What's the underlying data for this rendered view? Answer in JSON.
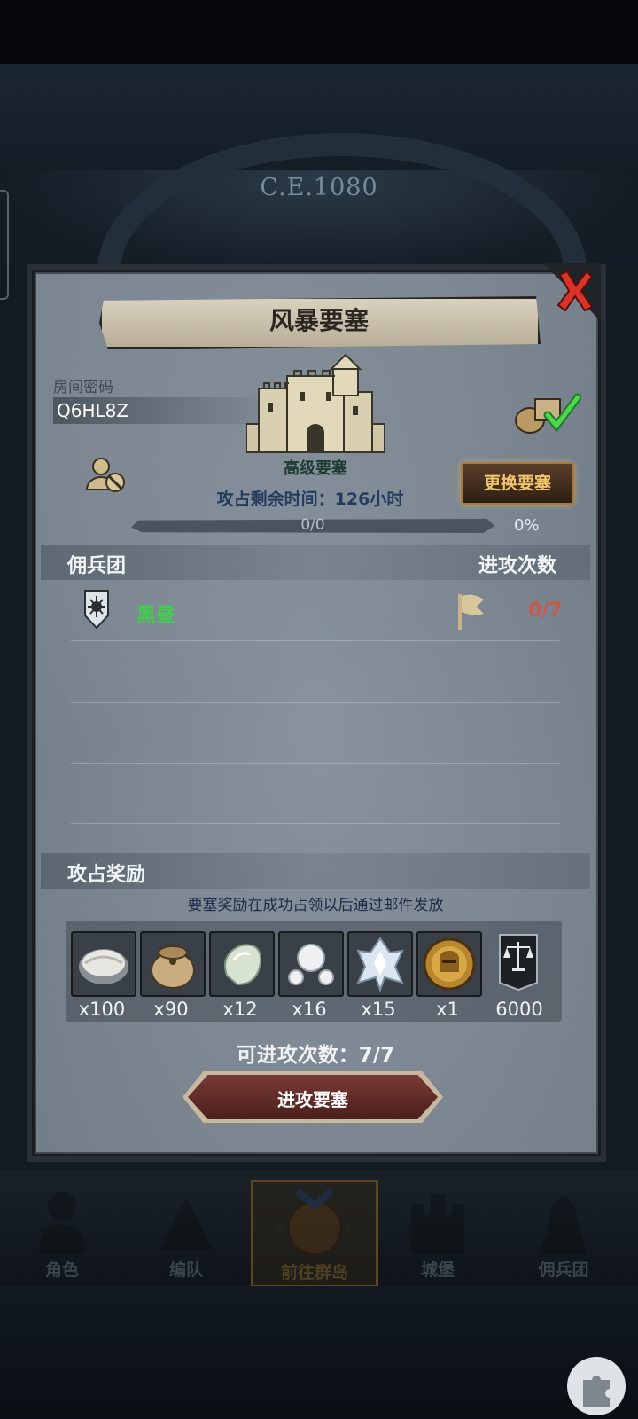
{
  "background": {
    "era_label": "C.E.1080"
  },
  "dialog": {
    "title": "风暴要塞",
    "room_code_label": "房间密码",
    "room_code": "Q6HL8Z",
    "fortress_level": "高级要塞",
    "change_button": "更换要塞",
    "time_remaining_label": "攻占剩余时间：",
    "time_remaining_value": "126小时",
    "progress_text": "0/0",
    "progress_percent": "0%",
    "progress_fraction": 0,
    "columns": {
      "mercenary": "佣兵团",
      "attacks": "进攻次数"
    },
    "rows": [
      {
        "guild": "黑昼",
        "attacks": "0/7"
      }
    ],
    "rewards_title": "攻占奖励",
    "rewards_note": "要塞奖励在成功占领以后通过邮件发放",
    "rewards": [
      {
        "icon": "oyster-icon",
        "qty": "x100"
      },
      {
        "icon": "sack-icon",
        "qty": "x90"
      },
      {
        "icon": "jade-stone-icon",
        "qty": "x12"
      },
      {
        "icon": "pearls-icon",
        "qty": "x16"
      },
      {
        "icon": "crystal-icon",
        "qty": "x15"
      },
      {
        "icon": "knight-medal-icon",
        "qty": "x1"
      },
      {
        "icon": "scales-banner-icon",
        "qty": "6000"
      }
    ],
    "available_attacks_label": "可进攻次数：",
    "available_attacks_value": "7/7",
    "attack_button": "进攻要塞"
  },
  "nav": {
    "items": [
      {
        "label": "角色"
      },
      {
        "label": "编队"
      },
      {
        "label": "前往群岛",
        "active": true
      },
      {
        "label": "城堡"
      },
      {
        "label": "佣兵团"
      }
    ]
  },
  "colors": {
    "guild_name": "#3fcf4a",
    "attack_count": "#c85a4a",
    "change_button_text": "#f3c56a",
    "attack_button": "#7a3a36"
  }
}
